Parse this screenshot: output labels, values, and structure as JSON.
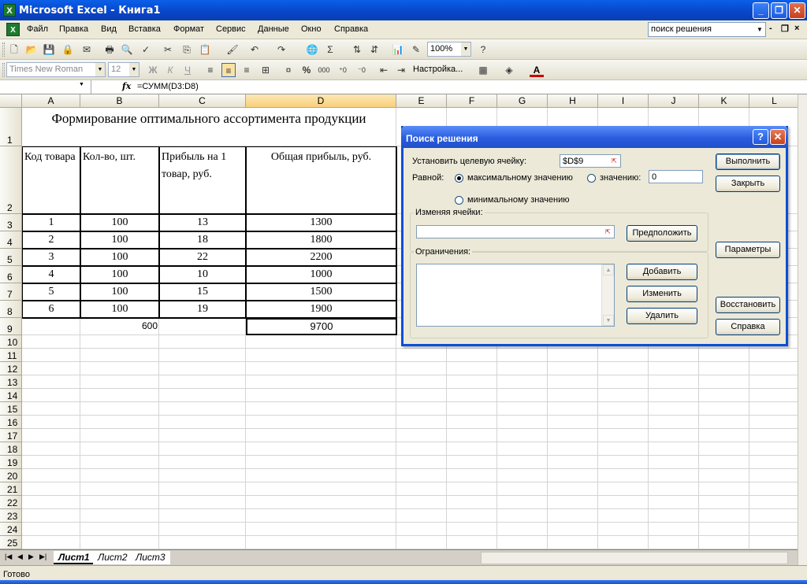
{
  "window": {
    "title": "Microsoft Excel - Книга1",
    "app_icon": "excel-icon"
  },
  "menu": {
    "items": [
      "Файл",
      "Правка",
      "Вид",
      "Вставка",
      "Формат",
      "Сервис",
      "Данные",
      "Окно",
      "Справка"
    ]
  },
  "help_search": {
    "value": "поиск решения"
  },
  "toolbar": {
    "zoom": "100%",
    "font": "Times New Roman",
    "size": "12",
    "bold": "Ж",
    "italic": "К",
    "underline": "Ч",
    "thousands": "000",
    "customize": "Настройка..."
  },
  "formula_bar": {
    "name_box": "",
    "fx": "fx",
    "formula": "=СУММ(D3:D8)"
  },
  "columns": [
    "A",
    "B",
    "C",
    "D",
    "E",
    "F",
    "G",
    "H",
    "I",
    "J",
    "K",
    "L"
  ],
  "rows": [
    "1",
    "2",
    "3",
    "4",
    "5",
    "6",
    "7",
    "8",
    "9",
    "10",
    "11",
    "12",
    "13",
    "14",
    "15",
    "16",
    "17",
    "18",
    "19",
    "20",
    "21",
    "22",
    "23",
    "24",
    "25"
  ],
  "sheet": {
    "title": "Формирование оптимального ассортимента продукции",
    "headers": [
      "Код товара",
      "Кол-во, шт.",
      "Прибыль на 1 товар, руб.",
      "Общая прибыль,  руб."
    ],
    "table": [
      [
        "1",
        "100",
        "13",
        "1300"
      ],
      [
        "2",
        "100",
        "18",
        "1800"
      ],
      [
        "3",
        "100",
        "22",
        "2200"
      ],
      [
        "4",
        "100",
        "10",
        "1000"
      ],
      [
        "5",
        "100",
        "15",
        "1500"
      ],
      [
        "6",
        "100",
        "19",
        "1900"
      ]
    ],
    "total_qty": "600",
    "total_profit": "9700"
  },
  "sheet_tabs": [
    "Лист1",
    "Лист2",
    "Лист3"
  ],
  "status": "Готово",
  "dialog": {
    "title": "Поиск решения",
    "target_label": "Установить целевую ячейку:",
    "target_value": "$D$9",
    "equal_label": "Равной:",
    "opt_max": "максимальному значению",
    "opt_value": "значению:",
    "value_field": "0",
    "opt_min": "минимальному значению",
    "changing_label": "Изменяя ячейки:",
    "changing_value": "",
    "guess": "Предположить",
    "constraints_label": "Ограничения:",
    "add": "Добавить",
    "change": "Изменить",
    "delete": "Удалить",
    "run": "Выполнить",
    "close": "Закрыть",
    "params": "Параметры",
    "restore": "Восстановить",
    "help": "Справка"
  }
}
